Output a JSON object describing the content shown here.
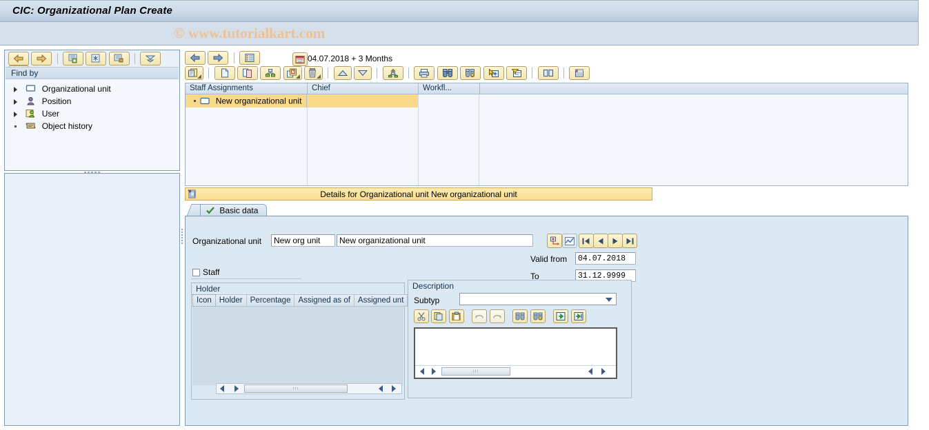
{
  "window": {
    "title": "CIC: Organizational Plan Create",
    "watermark": "© www.tutorialkart.com"
  },
  "sidebar": {
    "toolbar": [
      {
        "name": "back-button",
        "icon": "arrow-left-icon"
      },
      {
        "name": "forward-button",
        "icon": "arrow-right-icon"
      },
      {
        "name": "create-search-button",
        "icon": "new-search-icon"
      },
      {
        "name": "search-button",
        "icon": "asterisk-search-icon"
      },
      {
        "name": "delete-search-button",
        "icon": "delete-search-icon"
      },
      {
        "name": "collapse-all-button",
        "icon": "collapse-down-icon"
      },
      {
        "name": "expand-up-button",
        "icon": "expand-up-icon"
      }
    ],
    "header": "Find by",
    "items": [
      {
        "label": "Organizational unit",
        "icon": "org-unit-icon",
        "expandable": true
      },
      {
        "label": "Position",
        "icon": "position-icon",
        "expandable": true
      },
      {
        "label": "User",
        "icon": "user-icon",
        "expandable": true
      },
      {
        "label": "Object history",
        "icon": "history-icon",
        "expandable": false
      }
    ]
  },
  "main_toolbar": {
    "row1": [
      {
        "name": "nav-back-button",
        "icon": "arrow-left-icon"
      },
      {
        "name": "nav-forward-button",
        "icon": "arrow-right-icon"
      },
      {
        "name": "column-config-button",
        "icon": "list-config-icon"
      }
    ],
    "date_icon": "calendar-icon",
    "date_text": "04.07.2018  + 3 Months",
    "row2": [
      {
        "name": "create-button",
        "icon": "create-object-icon",
        "menu": true
      },
      {
        "name": "new-document-button",
        "icon": "blank-page-icon",
        "menu": false
      },
      {
        "name": "copy-button",
        "icon": "copy-pages-icon",
        "menu": false
      },
      {
        "name": "assign-button",
        "icon": "org-tree-icon",
        "menu": false
      },
      {
        "name": "delimit-button",
        "icon": "page-calendar-icon",
        "menu": true
      },
      {
        "name": "delete-button",
        "icon": "trash-icon",
        "menu": true
      },
      {
        "name": "move-up-button",
        "icon": "arrow-up-icon",
        "menu": false
      },
      {
        "name": "move-down-button",
        "icon": "arrow-down-icon",
        "menu": false
      },
      {
        "name": "upload-structure-button",
        "icon": "org-tree-up-icon",
        "menu": false
      },
      {
        "name": "print-button",
        "icon": "printer-icon",
        "menu": false
      },
      {
        "name": "find-button",
        "icon": "binoculars-icon",
        "menu": false
      },
      {
        "name": "find-next-button",
        "icon": "binoculars-plus-icon",
        "menu": false
      },
      {
        "name": "select-all-button",
        "icon": "cursor-plus-icon",
        "menu": false
      },
      {
        "name": "deselect-all-button",
        "icon": "filter-minus-icon",
        "menu": false
      },
      {
        "name": "layout-button",
        "icon": "layout-split-icon",
        "menu": false
      },
      {
        "name": "report-button",
        "icon": "spreadsheet-icon",
        "menu": false
      }
    ]
  },
  "grid": {
    "columns": [
      "Staff Assignments",
      "Chief",
      "Workfl..."
    ],
    "rows": [
      {
        "label": "New organizational unit",
        "icon": "org-unit-icon",
        "selected": true
      }
    ]
  },
  "details": {
    "header_icon": "details-icon",
    "header": "Details for Organizational unit New organizational unit",
    "tab": {
      "label": "Basic data",
      "icon": "check-icon"
    }
  },
  "form": {
    "org_unit_label": "Organizational unit",
    "org_unit_short": "New org unit",
    "org_unit_long": "New organizational unit",
    "valid_from_label": "Valid from",
    "valid_from_value": "04.07.2018",
    "to_label": "To",
    "to_value": "31.12.9999",
    "staff_label": "Staff",
    "staff_checked": false,
    "nav_buttons": [
      {
        "name": "relationship-button",
        "icon": "relationship-icon"
      },
      {
        "name": "graphics-button",
        "icon": "chart-icon"
      },
      {
        "name": "first-record-button",
        "icon": "first-icon"
      },
      {
        "name": "previous-record-button",
        "icon": "previous-icon"
      },
      {
        "name": "next-record-button",
        "icon": "next-icon"
      },
      {
        "name": "last-record-button",
        "icon": "last-icon"
      }
    ]
  },
  "holder": {
    "caption": "Holder",
    "columns": [
      "Icon",
      "Holder",
      "Percentage",
      "Assigned as of",
      "Assigned unt"
    ],
    "rows": []
  },
  "description": {
    "caption": "Description",
    "subtype_label": "Subtyp",
    "subtype_value": "",
    "subtype_options": [],
    "toolbar": [
      {
        "name": "cut-button",
        "icon": "scissors-icon"
      },
      {
        "name": "copy-button",
        "icon": "copy-icon"
      },
      {
        "name": "paste-button",
        "icon": "clipboard-icon"
      },
      {
        "name": "undo-button",
        "icon": "undo-icon"
      },
      {
        "name": "redo-button",
        "icon": "redo-icon"
      },
      {
        "name": "find-button",
        "icon": "binoculars-icon"
      },
      {
        "name": "find-next-button",
        "icon": "binoculars-plus-icon"
      },
      {
        "name": "import-text-button",
        "icon": "import-icon"
      },
      {
        "name": "export-text-button",
        "icon": "export-icon"
      }
    ],
    "text_value": ""
  },
  "colors": {
    "title_bar": "#cfdcea",
    "panel_bg": "#dde9f2",
    "grid_bg": "#f4f8fd",
    "selection": "#fad98a",
    "details_bar": "#f7dd8f",
    "watermark": "#f0c091",
    "button_face": "#f3e6ae"
  }
}
